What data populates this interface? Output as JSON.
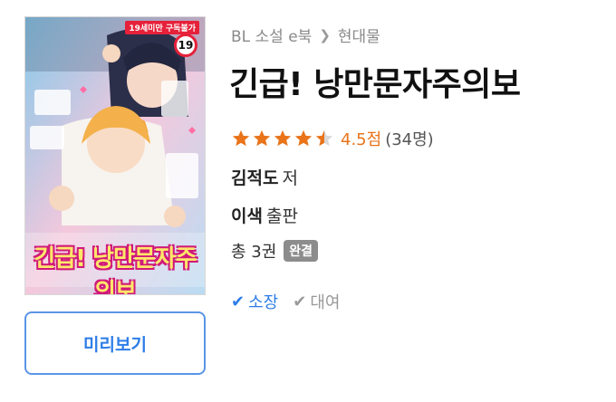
{
  "cover": {
    "rating_banner": "19세미만 구독불가",
    "age_badge": "19",
    "title_art": "긴급! 낭만문자주의보"
  },
  "preview_button": "미리보기",
  "breadcrumb": {
    "category": "BL 소설 e북",
    "subcategory": "현대물"
  },
  "title": "긴급! 낭만문자주의보",
  "rating": {
    "stars": 4.5,
    "score": "4.5점",
    "count": "(34명)",
    "color": "#e9741a"
  },
  "author": {
    "name": "김적도",
    "suffix": "저"
  },
  "publisher": {
    "name": "이색",
    "suffix": "출판"
  },
  "volumes": {
    "text": "총 3권",
    "status": "완결"
  },
  "options": {
    "own": "소장",
    "rent": "대여"
  },
  "colors": {
    "accent": "#2e7de8",
    "star": "#e9741a",
    "badge": "#8c8c8c"
  }
}
